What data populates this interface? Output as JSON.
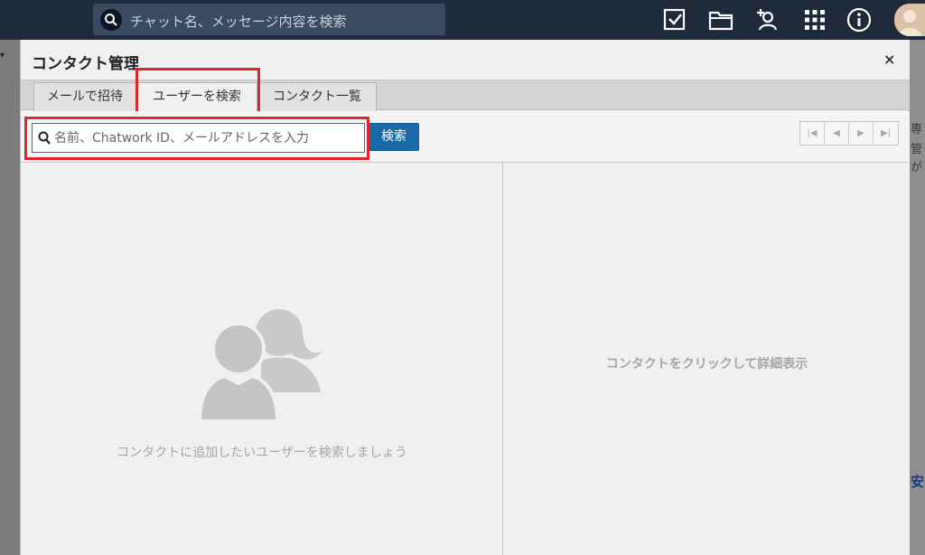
{
  "topbar": {
    "search_placeholder": "チャット名、メッセージ内容を検索",
    "icons": [
      "search-icon",
      "task-check-icon",
      "folder-icon",
      "add-contact-icon",
      "apps-grid-icon",
      "info-icon",
      "user-avatar"
    ]
  },
  "background": {
    "fragments": [
      "専",
      "管",
      "が",
      "安"
    ]
  },
  "dialog": {
    "title": "コンタクト管理",
    "close_label": "×",
    "tabs": [
      {
        "label": "メールで招待",
        "active": false
      },
      {
        "label": "ユーザーを検索",
        "active": true
      },
      {
        "label": "コンタクト一覧",
        "active": false
      }
    ],
    "search": {
      "placeholder": "名前、Chatwork ID、メールアドレスを入力",
      "value": "",
      "button_label": "検索"
    },
    "pager": [
      "first-page-icon",
      "prev-page-icon",
      "next-page-icon",
      "last-page-icon"
    ],
    "left_empty_text": "コンタクトに追加したいユーザーを検索しましょう",
    "right_empty_text": "コンタクトをクリックして詳細表示"
  },
  "colors": {
    "topbar_bg": "#1f2a3a",
    "accent_blue": "#1a6aa8",
    "highlight_red": "#e0262b",
    "placeholder_gray": "#a6a6a6"
  }
}
